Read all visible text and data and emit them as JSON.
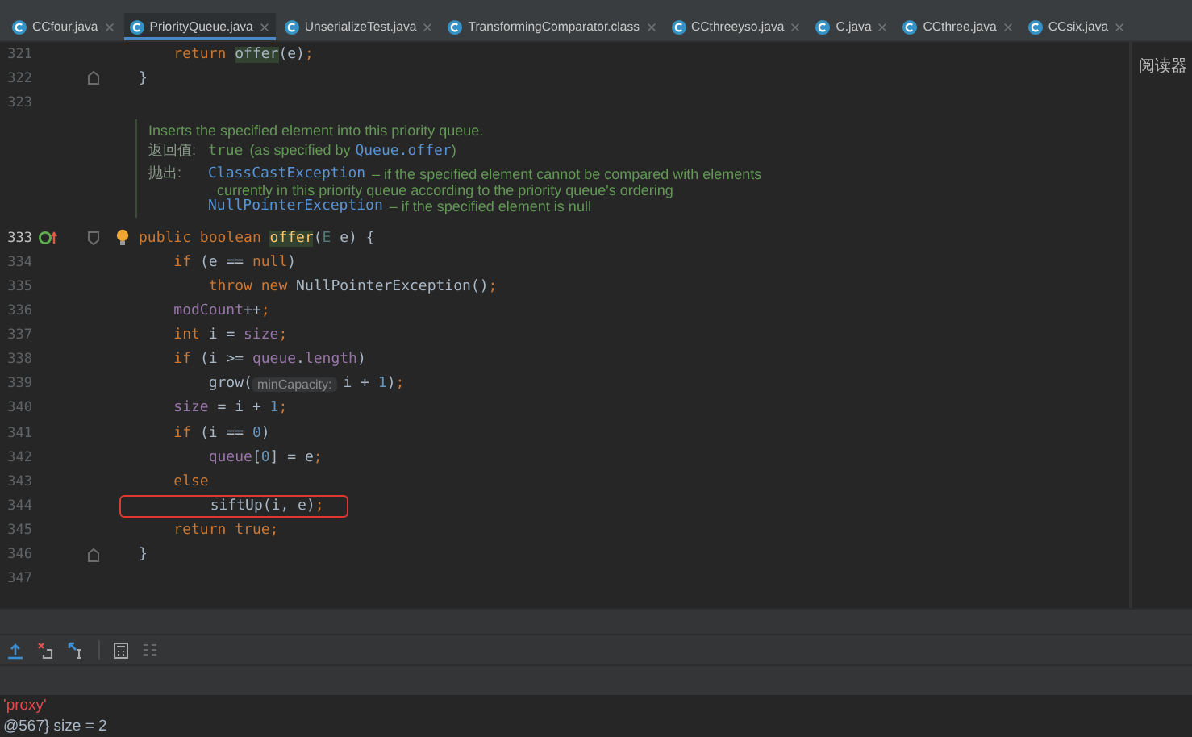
{
  "tabs": [
    {
      "label": "CCfour.java",
      "selected": false
    },
    {
      "label": "PriorityQueue.java",
      "selected": true
    },
    {
      "label": "UnserializeTest.java",
      "selected": false
    },
    {
      "label": "TransformingComparator.class",
      "selected": false
    },
    {
      "label": "CCthreeyso.java",
      "selected": false
    },
    {
      "label": "C.java",
      "selected": false
    },
    {
      "label": "CCthree.java",
      "selected": false
    },
    {
      "label": "CCsix.java",
      "selected": false
    }
  ],
  "editor": {
    "lines": [
      {
        "kind": "code",
        "number": "321",
        "boxed": false,
        "tokens": [
          {
            "text": "    return ",
            "kind": "keyword"
          },
          {
            "text": "offer",
            "kind": "usage"
          },
          {
            "text": "(e)",
            "kind": "plain"
          },
          {
            "text": ";",
            "kind": "keyword"
          }
        ]
      },
      {
        "kind": "fold_end",
        "number": "322",
        "boxed": false,
        "tokens": [
          {
            "text": "}",
            "kind": "plain"
          }
        ]
      },
      {
        "kind": "code",
        "number": "323",
        "boxed": false
      },
      {
        "kind": "doc",
        "summary": "Inserts the specified element into this priority queue.",
        "returns": {
          "label": "返回值:",
          "code": "true",
          "text": "(as specified by",
          "link": "Queue.offer",
          "tail": ")"
        },
        "throws": {
          "label": "抛出:",
          "items": [
            {
              "name": "ClassCastException",
              "lines": [
                "– if the specified element cannot be compared with elements",
                "currently in this priority queue according to the priority queue's ordering"
              ]
            },
            {
              "name": "NullPointerException",
              "lines": [
                "– if the specified element is null"
              ]
            }
          ]
        }
      },
      {
        "kind": "method",
        "number": "333",
        "boxed": false,
        "tokens": [
          {
            "text": "public boolean ",
            "kind": "keyword"
          },
          {
            "text": "offer",
            "kind": "declaration"
          },
          {
            "text": "(",
            "kind": "plain"
          },
          {
            "text": "E",
            "kind": "type"
          },
          {
            "text": " e) {",
            "kind": "plain"
          }
        ]
      },
      {
        "kind": "code",
        "number": "334",
        "boxed": false,
        "tokens": [
          {
            "text": "    if ",
            "kind": "keyword"
          },
          {
            "text": "(e == ",
            "kind": "plain"
          },
          {
            "text": "null",
            "kind": "keyword"
          },
          {
            "text": ")",
            "kind": "plain"
          }
        ]
      },
      {
        "kind": "code",
        "number": "335",
        "boxed": false,
        "tokens": [
          {
            "text": "        throw new ",
            "kind": "keyword"
          },
          {
            "text": "NullPointerException()",
            "kind": "plain"
          },
          {
            "text": ";",
            "kind": "keyword"
          }
        ]
      },
      {
        "kind": "code",
        "number": "336",
        "boxed": false,
        "tokens": [
          {
            "text": "    modCount",
            "kind": "field"
          },
          {
            "text": "++",
            "kind": "plain"
          },
          {
            "text": ";",
            "kind": "keyword"
          }
        ]
      },
      {
        "kind": "code",
        "number": "337",
        "boxed": false,
        "tokens": [
          {
            "text": "    int ",
            "kind": "keyword"
          },
          {
            "text": "i = ",
            "kind": "plain"
          },
          {
            "text": "size",
            "kind": "field"
          },
          {
            "text": ";",
            "kind": "keyword"
          }
        ]
      },
      {
        "kind": "code",
        "number": "338",
        "boxed": false,
        "tokens": [
          {
            "text": "    if ",
            "kind": "keyword"
          },
          {
            "text": "(i >= ",
            "kind": "plain"
          },
          {
            "text": "queue",
            "kind": "field"
          },
          {
            "text": ".",
            "kind": "plain"
          },
          {
            "text": "length",
            "kind": "field"
          },
          {
            "text": ")",
            "kind": "plain"
          }
        ]
      },
      {
        "kind": "code",
        "number": "339",
        "boxed": false,
        "tokens": [
          {
            "text": "        grow(",
            "kind": "plain"
          },
          {
            "text": "minCapacity:",
            "kind": "hint"
          },
          {
            "text": "i + ",
            "kind": "plain"
          },
          {
            "text": "1",
            "kind": "number"
          },
          {
            "text": ")",
            "kind": "plain"
          },
          {
            "text": ";",
            "kind": "keyword"
          }
        ]
      },
      {
        "kind": "code",
        "number": "340",
        "boxed": false,
        "tokens": [
          {
            "text": "    size",
            "kind": "field"
          },
          {
            "text": " = i + ",
            "kind": "plain"
          },
          {
            "text": "1",
            "kind": "number"
          },
          {
            "text": ";",
            "kind": "keyword"
          }
        ]
      },
      {
        "kind": "code",
        "number": "341",
        "boxed": false,
        "tokens": [
          {
            "text": "    if ",
            "kind": "keyword"
          },
          {
            "text": "(i == ",
            "kind": "plain"
          },
          {
            "text": "0",
            "kind": "number"
          },
          {
            "text": ")",
            "kind": "plain"
          }
        ]
      },
      {
        "kind": "code",
        "number": "342",
        "boxed": false,
        "tokens": [
          {
            "text": "        queue",
            "kind": "field"
          },
          {
            "text": "[",
            "kind": "plain"
          },
          {
            "text": "0",
            "kind": "number"
          },
          {
            "text": "] = e",
            "kind": "plain"
          },
          {
            "text": ";",
            "kind": "keyword"
          }
        ]
      },
      {
        "kind": "code",
        "number": "343",
        "boxed": false,
        "tokens": [
          {
            "text": "    else",
            "kind": "keyword"
          }
        ]
      },
      {
        "kind": "code",
        "number": "344",
        "boxed": true,
        "tokens": [
          {
            "text": "        siftUp(i, e)",
            "kind": "plain"
          },
          {
            "text": ";",
            "kind": "keyword"
          }
        ]
      },
      {
        "kind": "code",
        "number": "345",
        "boxed": false,
        "tokens": [
          {
            "text": "    return true",
            "kind": "keyword"
          },
          {
            "text": ";",
            "kind": "keyword"
          }
        ]
      },
      {
        "kind": "fold_end",
        "number": "346",
        "boxed": false,
        "tokens": [
          {
            "text": "}",
            "kind": "plain"
          }
        ]
      },
      {
        "kind": "code",
        "number": "347",
        "boxed": false
      }
    ]
  },
  "side_panel": {
    "title": "阅读器"
  },
  "variables": [
    {
      "text": "'proxy'",
      "kind": "error"
    },
    {
      "text": "@567} size = 2",
      "kind": "plain"
    }
  ]
}
